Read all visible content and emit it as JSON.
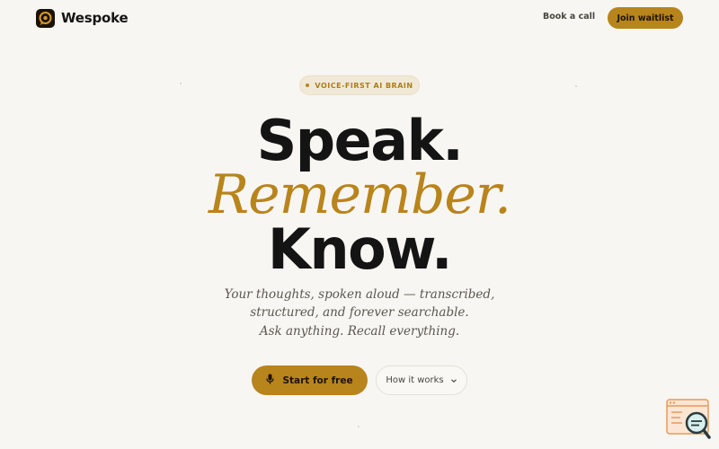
{
  "header": {
    "brand": "Wespoke",
    "book_call": "Book a call",
    "join_waitlist": "Join waitlist"
  },
  "hero": {
    "badge": "VOICE-FIRST AI BRAIN",
    "line1": "Speak.",
    "line2": "Remember.",
    "line3": "Know.",
    "subtitle": [
      "Your thoughts, spoken aloud — transcribed,",
      "structured, and forever searchable.",
      "Ask anything. Recall everything."
    ],
    "primary_cta": "Start for free",
    "secondary_cta": "How it works"
  },
  "icons": {
    "logo": "logo-mark-icon",
    "mic": "microphone-icon",
    "chevron": "chevron-down-icon",
    "widget": "search-window-icon"
  },
  "colors": {
    "background": "#f8f6f2",
    "accent": "#b8841c",
    "text": "#141414",
    "muted": "#5b5650"
  }
}
